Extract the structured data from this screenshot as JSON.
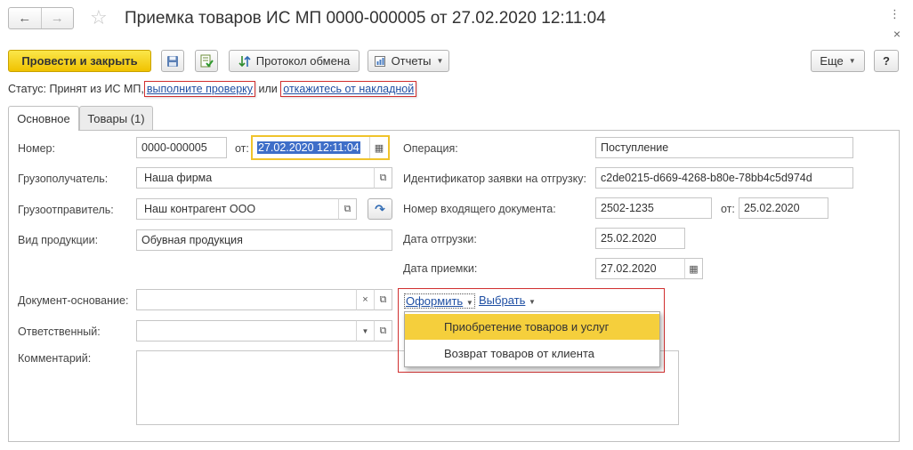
{
  "window": {
    "title": "Приемка товаров ИС МП 0000-000005 от 27.02.2020 12:11:04",
    "nav_back": "←",
    "nav_forward": "→",
    "favorite_icon": "star-icon",
    "menu_dots": "⋮",
    "close": "×"
  },
  "toolbar": {
    "post_close": "Провести и закрыть",
    "save_icon": "save-icon",
    "post_icon": "post-icon",
    "exchange_log": "Протокол обмена",
    "reports": "Отчеты",
    "more": "Еще",
    "help": "?"
  },
  "status": {
    "label": "Статус:",
    "text": "Принят из ИС МП,",
    "link_check": "выполните проверку",
    "or": "или",
    "link_reject": "откажитесь от накладной"
  },
  "tabs": {
    "main": "Основное",
    "goods": "Товары (1)"
  },
  "form": {
    "number_label": "Номер:",
    "number_value": "0000-000005",
    "from_label": "от:",
    "date_value": "27.02.2020 12:11:04",
    "consignee_label": "Грузополучатель:",
    "consignee_value": "Наша фирма",
    "shipper_label": "Грузоотправитель:",
    "shipper_value": "Наш контрагент ООО",
    "product_type_label": "Вид продукции:",
    "product_type_value": "Обувная продукция",
    "operation_label": "Операция:",
    "operation_value": "Поступление",
    "shipment_id_label": "Идентификатор заявки на отгрузку:",
    "shipment_id_value": "c2de0215-d669-4268-b80e-78bb4c5d974d",
    "incoming_doc_label": "Номер входящего документа:",
    "incoming_doc_value": "2502-1235",
    "incoming_from_label": "от:",
    "incoming_date_value": "25.02.2020",
    "ship_date_label": "Дата отгрузки:",
    "ship_date_value": "25.02.2020",
    "accept_date_label": "Дата приемки:",
    "accept_date_value": "27.02.2020",
    "base_doc_label": "Документ-основание:",
    "base_doc_value": "",
    "clear_mark": "×",
    "responsible_label": "Ответственный:",
    "responsible_value": "",
    "comment_label": "Комментарий:",
    "comment_value": ""
  },
  "links": {
    "create": "Оформить",
    "choose": "Выбрать"
  },
  "dropdown": {
    "items": [
      "Приобретение товаров и услуг",
      "Возврат товаров от клиента"
    ],
    "highlighted_index": 0
  },
  "colors": {
    "primary_button": "#f5d20f",
    "link": "#1f4fa3",
    "highlight": "#f5cf3c",
    "annotation_border": "#d02f2f",
    "focus_border": "#f0c32b"
  }
}
